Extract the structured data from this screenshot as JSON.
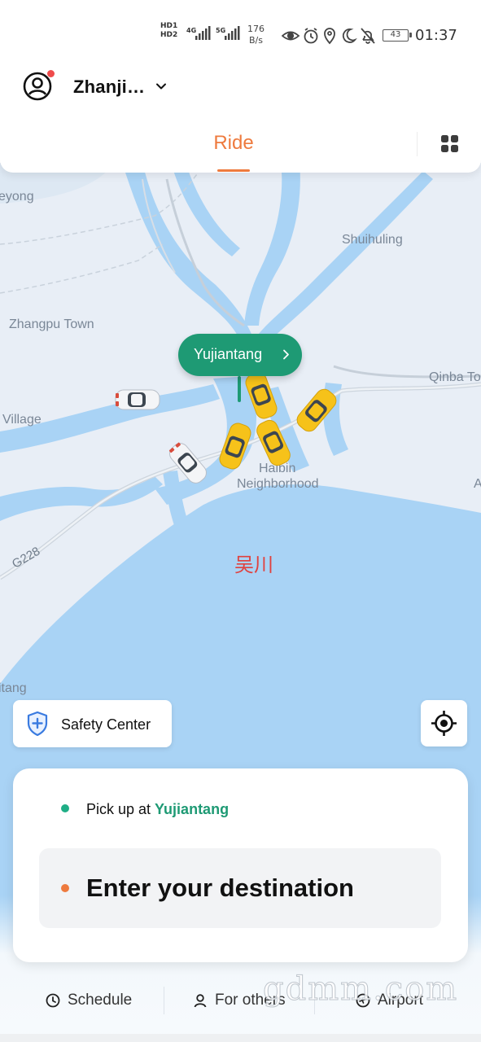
{
  "status_bar": {
    "hd1": "HD1",
    "hd2": "HD2",
    "net1": "4G",
    "net2": "5G",
    "speed_value": "176",
    "speed_unit": "B/s",
    "battery": "43",
    "time": "01:37",
    "icons": [
      "eye-icon",
      "alarm-icon",
      "location-icon",
      "moon-icon",
      "bell-off-icon"
    ]
  },
  "header": {
    "city": "Zhanji…",
    "tab_ride": "Ride"
  },
  "map": {
    "labels": {
      "yeyong": "eyong",
      "shuihuling": "Shuihuling",
      "zhangpu": "Zhangpu Town",
      "qinba": "Qinba To",
      "village": "Village",
      "haibin": "Haibin",
      "neighborhood": "Neighborhood",
      "a": "A",
      "road": "G228",
      "itang": "itang",
      "wuchuan": "吴川"
    },
    "pickup_pin": "Yujiantang"
  },
  "safety_center": {
    "label": "Safety Center"
  },
  "card": {
    "pickup_prefix": "Pick up at ",
    "pickup_place": "Yujiantang",
    "destination_placeholder": "Enter your destination"
  },
  "bottom_nav": {
    "schedule": "Schedule",
    "for_others": "For others",
    "airport": "Airport"
  },
  "watermark": "gdmm.com",
  "colors": {
    "accent_orange": "#ee7a3e",
    "accent_green": "#1e9a74",
    "map_water": "#a9d3f5",
    "map_land": "#e8eef6"
  }
}
